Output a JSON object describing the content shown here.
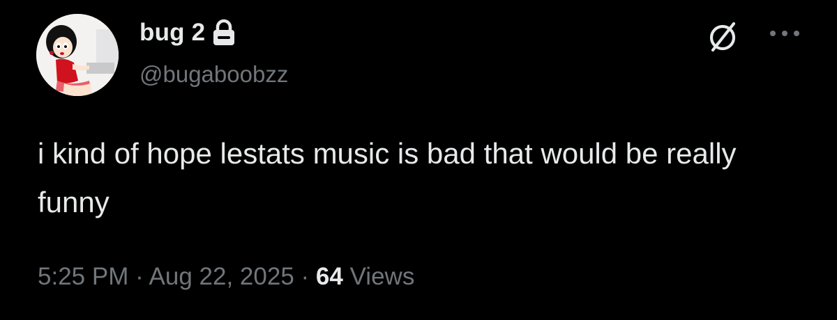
{
  "author": {
    "display_name": "bug 2",
    "handle": "@bugaboobzz",
    "protected_icon": "lock-icon",
    "avatar_icon": "avatar-image"
  },
  "header_actions": {
    "grok_icon": "grok-icon",
    "more_icon": "more-options-icon"
  },
  "tweet": {
    "text": "i kind of hope lestats music is bad that would be really funny",
    "time": "5:25 PM",
    "separator": "·",
    "date": "Aug 22, 2025",
    "views_count": "64",
    "views_label": "Views"
  },
  "colors": {
    "background": "#000000",
    "primary_text": "#e7e9ea",
    "secondary_text": "#71767b"
  }
}
